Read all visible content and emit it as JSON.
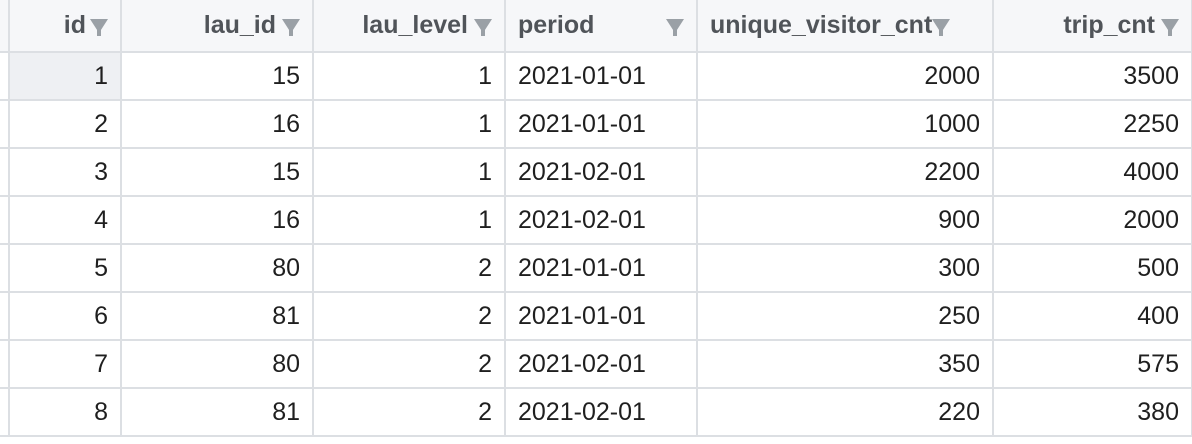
{
  "table": {
    "columns": [
      {
        "key": "id",
        "label": "id",
        "align": "right"
      },
      {
        "key": "lau_id",
        "label": "lau_id",
        "align": "right"
      },
      {
        "key": "lau_level",
        "label": "lau_level",
        "align": "right"
      },
      {
        "key": "period",
        "label": "period",
        "align": "left"
      },
      {
        "key": "unique_visitor_cnt",
        "label": "unique_visitor_cnt",
        "align": "right"
      },
      {
        "key": "trip_cnt",
        "label": "trip_cnt",
        "align": "right"
      }
    ],
    "filter_icon": "filter-funnel-icon",
    "rows": [
      {
        "id": "1",
        "lau_id": "15",
        "lau_level": "1",
        "period": "2021-01-01",
        "unique_visitor_cnt": "2000",
        "trip_cnt": "3500"
      },
      {
        "id": "2",
        "lau_id": "16",
        "lau_level": "1",
        "period": "2021-01-01",
        "unique_visitor_cnt": "1000",
        "trip_cnt": "2250"
      },
      {
        "id": "3",
        "lau_id": "15",
        "lau_level": "1",
        "period": "2021-02-01",
        "unique_visitor_cnt": "2200",
        "trip_cnt": "4000"
      },
      {
        "id": "4",
        "lau_id": "16",
        "lau_level": "1",
        "period": "2021-02-01",
        "unique_visitor_cnt": "900",
        "trip_cnt": "2000"
      },
      {
        "id": "5",
        "lau_id": "80",
        "lau_level": "2",
        "period": "2021-01-01",
        "unique_visitor_cnt": "300",
        "trip_cnt": "500"
      },
      {
        "id": "6",
        "lau_id": "81",
        "lau_level": "2",
        "period": "2021-01-01",
        "unique_visitor_cnt": "250",
        "trip_cnt": "400"
      },
      {
        "id": "7",
        "lau_id": "80",
        "lau_level": "2",
        "period": "2021-02-01",
        "unique_visitor_cnt": "350",
        "trip_cnt": "575"
      },
      {
        "id": "8",
        "lau_id": "81",
        "lau_level": "2",
        "period": "2021-02-01",
        "unique_visitor_cnt": "220",
        "trip_cnt": "380"
      }
    ]
  },
  "colors": {
    "border": "#dcdfe3",
    "header_bg": "#f6f7f9",
    "header_text": "#505459",
    "icon": "#9aa0a6",
    "selected_cell_bg": "#eef0f3"
  }
}
